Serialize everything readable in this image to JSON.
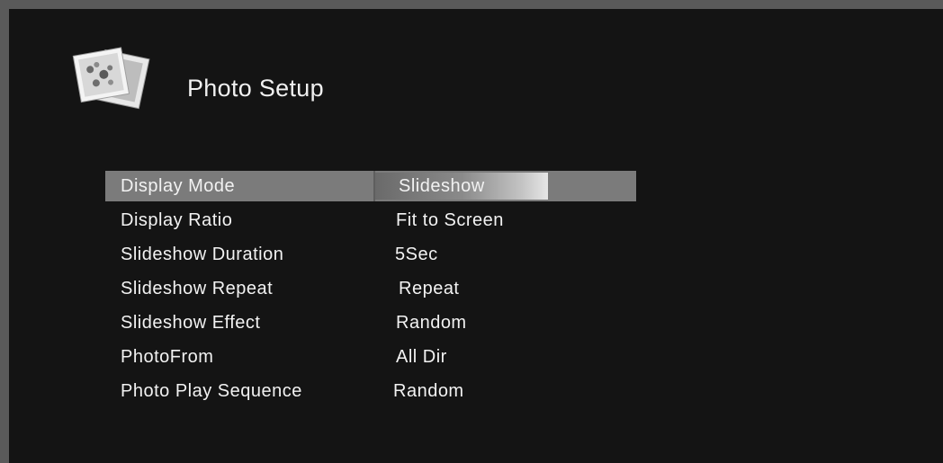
{
  "header": {
    "icon": "photo-stack-icon",
    "title": "Photo Setup"
  },
  "menu": {
    "items": [
      {
        "label": "Display Mode",
        "value": "Slideshow",
        "selected": true
      },
      {
        "label": "Display Ratio",
        "value": "Fit to Screen"
      },
      {
        "label": "Slideshow Duration",
        "value": "5Sec"
      },
      {
        "label": "Slideshow Repeat",
        "value": "Repeat"
      },
      {
        "label": "Slideshow Effect",
        "value": "Random"
      },
      {
        "label": "PhotoFrom",
        "value": "All Dir"
      },
      {
        "label": "Photo Play Sequence",
        "value": "Random"
      }
    ]
  },
  "colors": {
    "background": "#141414",
    "highlight": "#7b7b7b",
    "text": "#f2f2f2"
  }
}
